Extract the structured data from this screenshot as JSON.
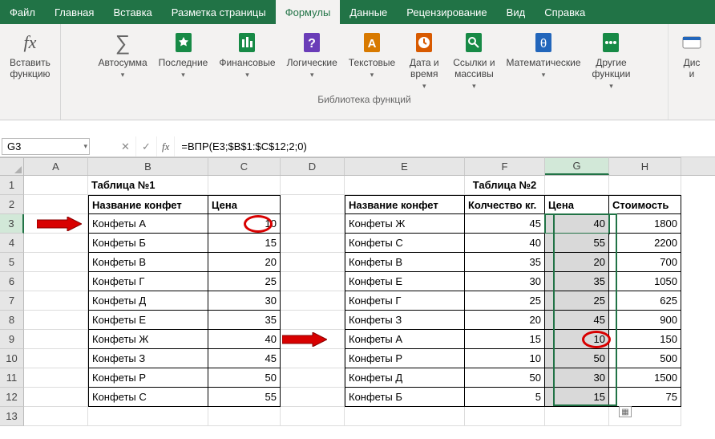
{
  "tabs": [
    "Файл",
    "Главная",
    "Вставка",
    "Разметка страницы",
    "Формулы",
    "Данные",
    "Рецензирование",
    "Вид",
    "Справка"
  ],
  "active_tab_index": 4,
  "ribbon": {
    "insert_fn": "Вставить\nфункцию",
    "autosum": "Автосумма",
    "recent": "Последние",
    "financial": "Финансовые",
    "logical": "Логические",
    "text": "Текстовые",
    "datetime": "Дата и\nвремя",
    "lookup": "Ссылки и\nмассивы",
    "math": "Математические",
    "more": "Другие\nфункции",
    "dispatch": "Дис\nи",
    "group_label": "Библиотека функций"
  },
  "namebox": "G3",
  "formula": "=ВПР(E3;$B$1:$C$12;2;0)",
  "columns": [
    "A",
    "B",
    "C",
    "D",
    "E",
    "F",
    "G",
    "H"
  ],
  "rownums": [
    "1",
    "2",
    "3",
    "4",
    "5",
    "6",
    "7",
    "8",
    "9",
    "10",
    "11",
    "12",
    "13"
  ],
  "selected_col_index": 6,
  "selected_row_index": 2,
  "table1": {
    "title": "Таблица №1",
    "headers": [
      "Название конфет",
      "Цена"
    ],
    "rows": [
      [
        "Конфеты А",
        "10"
      ],
      [
        "Конфеты Б",
        "15"
      ],
      [
        "Конфеты В",
        "20"
      ],
      [
        "Конфеты Г",
        "25"
      ],
      [
        "Конфеты Д",
        "30"
      ],
      [
        "Конфеты Е",
        "35"
      ],
      [
        "Конфеты Ж",
        "40"
      ],
      [
        "Конфеты З",
        "45"
      ],
      [
        "Конфеты Р",
        "50"
      ],
      [
        "Конфеты С",
        "55"
      ]
    ]
  },
  "table2": {
    "title": "Таблица №2",
    "headers": [
      "Название конфет",
      "Колчество кг.",
      "Цена",
      "Стоимость"
    ],
    "rows": [
      [
        "Конфеты Ж",
        "45",
        "40",
        "1800"
      ],
      [
        "Конфеты С",
        "40",
        "55",
        "2200"
      ],
      [
        "Конфеты В",
        "35",
        "20",
        "700"
      ],
      [
        "Конфеты Е",
        "30",
        "35",
        "1050"
      ],
      [
        "Конфеты Г",
        "25",
        "25",
        "625"
      ],
      [
        "Конфеты З",
        "20",
        "45",
        "900"
      ],
      [
        "Конфеты А",
        "15",
        "10",
        "150"
      ],
      [
        "Конфеты Р",
        "10",
        "50",
        "500"
      ],
      [
        "Конфеты Д",
        "50",
        "30",
        "1500"
      ],
      [
        "Конфеты Б",
        "5",
        "15",
        "75"
      ]
    ]
  }
}
